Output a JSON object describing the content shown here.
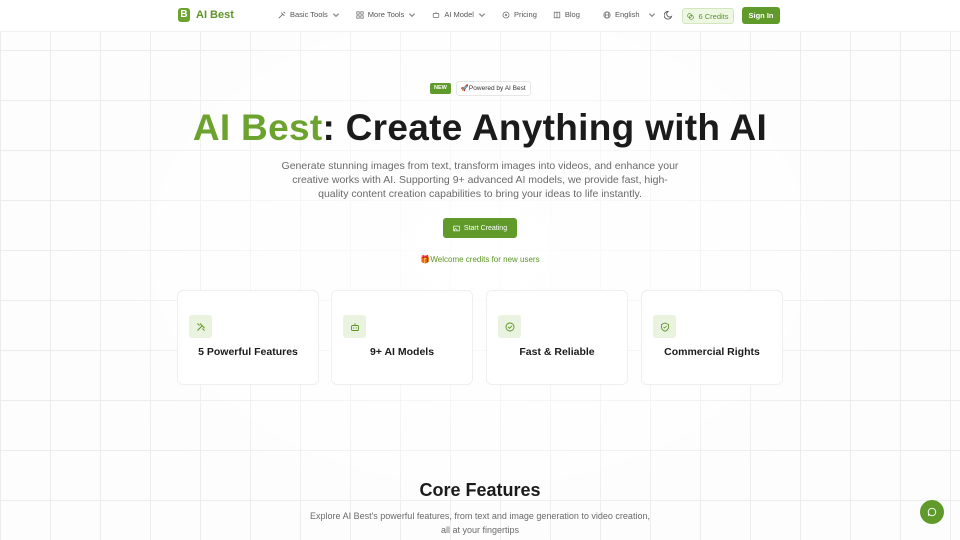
{
  "brand": {
    "logo_letter": "B",
    "name": "AI Best",
    "accent_color": "#5f9a2a"
  },
  "nav": {
    "items": [
      {
        "label": "Basic Tools",
        "icon": "tools-icon",
        "has_dropdown": true
      },
      {
        "label": "More Tools",
        "icon": "grid-icon",
        "has_dropdown": true
      },
      {
        "label": "AI Model",
        "icon": "robot-icon",
        "has_dropdown": true
      },
      {
        "label": "Pricing",
        "icon": "tag-icon",
        "has_dropdown": false
      },
      {
        "label": "Blog",
        "icon": "book-icon",
        "has_dropdown": false
      }
    ],
    "language": "English",
    "credits": "6 Credits",
    "signin": "Sign In"
  },
  "hero": {
    "badge_new": "NEW",
    "badge_text": "🚀Powered by AI Best",
    "title_brand": "AI Best",
    "title_rest": ": Create Anything with AI",
    "description": "Generate stunning images from text, transform images into videos, and enhance your creative works with AI. Supporting 9+ advanced AI models, we provide fast, high-quality content creation capabilities to bring your ideas to life instantly.",
    "cta": "Start Creating",
    "welcome": "🎁Welcome credits for new users"
  },
  "features": [
    {
      "label": "5 Powerful Features",
      "icon": "tools-icon"
    },
    {
      "label": "9+ AI Models",
      "icon": "robot-icon"
    },
    {
      "label": "Fast & Reliable",
      "icon": "check-circle-icon"
    },
    {
      "label": "Commercial Rights",
      "icon": "shield-icon"
    }
  ],
  "core": {
    "title": "Core Features",
    "description": "Explore AI Best's powerful features, from text and image generation to video creation, all at your fingertips"
  }
}
